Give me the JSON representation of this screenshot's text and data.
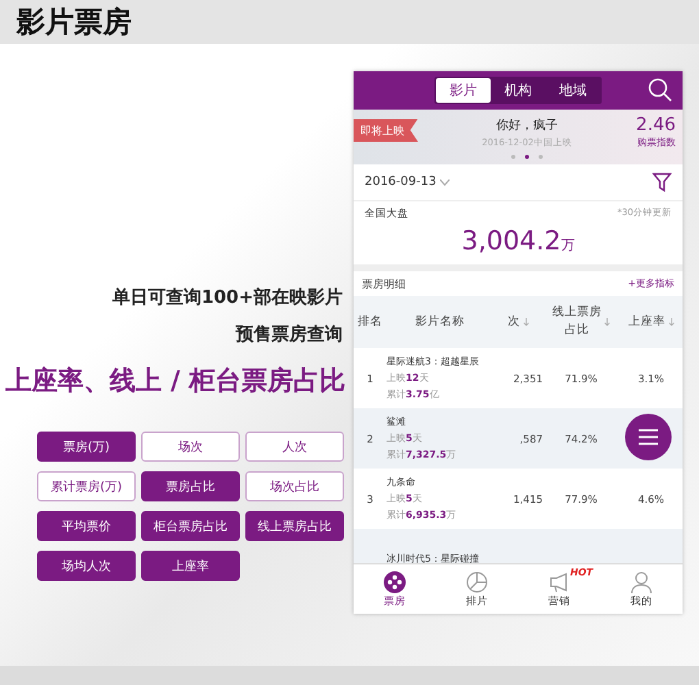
{
  "header": {
    "title": "影片票房"
  },
  "features": {
    "lines": [
      "单日可查询100+部在映影片",
      "预售票房查询"
    ],
    "highlight": "上座率、线上 / 柜台票房占比"
  },
  "metric_buttons": [
    {
      "label": "票房(万)",
      "selected": true
    },
    {
      "label": "场次",
      "selected": false
    },
    {
      "label": "人次",
      "selected": false
    },
    {
      "label": "累计票房(万)",
      "selected": false
    },
    {
      "label": "票房占比",
      "selected": true
    },
    {
      "label": "场次占比",
      "selected": false
    },
    {
      "label": "平均票价",
      "selected": true
    },
    {
      "label": "柜台票房占比",
      "selected": true
    },
    {
      "label": "线上票房占比",
      "selected": true
    },
    {
      "label": "场均人次",
      "selected": true
    },
    {
      "label": "上座率",
      "selected": true
    }
  ],
  "phone": {
    "tabs": [
      {
        "label": "影片",
        "selected": true
      },
      {
        "label": "机构",
        "selected": false
      },
      {
        "label": "地域",
        "selected": false
      }
    ],
    "banner": {
      "tag": "即将上映",
      "title": "你好，疯子",
      "subtitle": "2016-12-02中国上映",
      "score": "2.46",
      "score_label": "购票指数",
      "pages": [
        {
          "selected": false
        },
        {
          "selected": true
        },
        {
          "selected": false
        }
      ]
    },
    "date": "2016-09-13",
    "total": {
      "label": "全国大盘",
      "note": "*30分钟更新",
      "value": "3,004.2",
      "unit": "万"
    },
    "detail": {
      "title": "票房明细",
      "more": "+更多指标"
    },
    "columns": [
      {
        "label": "排名",
        "sortable": false
      },
      {
        "label": "影片名称",
        "sortable": false
      },
      {
        "label": "次",
        "sortable": true
      },
      {
        "label": "线上票房占比",
        "sortable": true
      },
      {
        "label": "上座率",
        "sortable": true
      }
    ],
    "rows": [
      {
        "rank": "1",
        "name": "星际迷航3：超越星辰",
        "days": "上映**12**天",
        "total": "累计**3.75**亿",
        "col_3": "2,351",
        "share": "71.9%",
        "rate": "3.1%"
      },
      {
        "rank": "2",
        "name": "鲨滩",
        "days": "上映**5**天",
        "total": "累计**7,327.5**万",
        "col_3": ",587",
        "share": "74.2%"
      },
      {
        "rank": "3",
        "name": "九条命",
        "days": "上映**5**天",
        "total": "累计**6,935.3**万",
        "col_3": "1,415",
        "share": "77.9%",
        "rate": "4.6%"
      },
      {
        "name": "冰川时代5：星际碰撞"
      }
    ],
    "nav": [
      {
        "label": "票房",
        "selected": true
      },
      {
        "label": "排片",
        "selected": false
      },
      {
        "label": "营销",
        "selected": false,
        "badge": "HOT"
      },
      {
        "label": "我的",
        "selected": false
      }
    ]
  }
}
